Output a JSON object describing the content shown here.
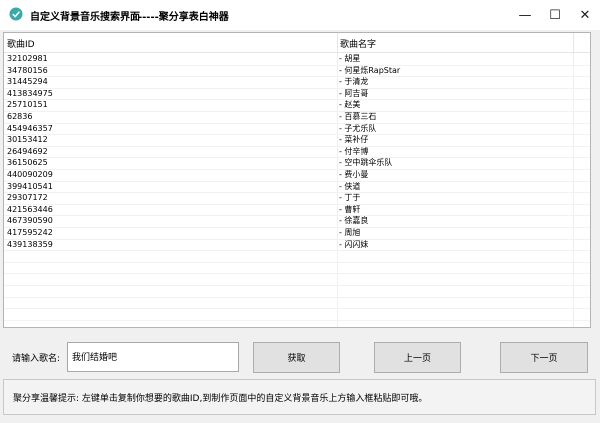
{
  "window": {
    "title": "自定义背景音乐搜索界面",
    "subtitle": "-----聚分享表白神器",
    "minimize": "—",
    "maximize": "☐",
    "close": "✕"
  },
  "list": {
    "columns": [
      "歌曲ID",
      "歌曲名字"
    ],
    "rows": [
      {
        "id": "32102981",
        "name": "- 胡星"
      },
      {
        "id": "34780156",
        "name": "- 何星烁RapStar"
      },
      {
        "id": "31445294",
        "name": "- 于清龙"
      },
      {
        "id": "413834975",
        "name": "- 阿吉哥"
      },
      {
        "id": "25710151",
        "name": "- 赵美"
      },
      {
        "id": "62836",
        "name": "- 百慕三石"
      },
      {
        "id": "454946357",
        "name": "- 子尤乐队"
      },
      {
        "id": "30153412",
        "name": "- 菜补仔"
      },
      {
        "id": "26494692",
        "name": "- 付辛博"
      },
      {
        "id": "36150625",
        "name": "- 空中跳伞乐队"
      },
      {
        "id": "440090209",
        "name": "- 费小曼"
      },
      {
        "id": "399410541",
        "name": "- 侠道"
      },
      {
        "id": "29307172",
        "name": "- 丁于"
      },
      {
        "id": "421563446",
        "name": "- 曹轩"
      },
      {
        "id": "467390590",
        "name": "- 徐嘉良"
      },
      {
        "id": "417595242",
        "name": "- 周旭"
      },
      {
        "id": "439138359",
        "name": "- 闪闪妹"
      }
    ]
  },
  "controls": {
    "input_label": "请输入歌名:",
    "input_value": "我们结婚吧",
    "search_button": "获取",
    "prev_button": "上一页",
    "next_button": "下一页"
  },
  "tip": "聚分享温馨提示: 左键单击复制你想要的歌曲ID,到制作页面中的自定义背景音乐上方输入框粘贴即可哦。",
  "colors": {
    "app_icon": "#3aa9a9"
  },
  "icons": {
    "app": "app-logo-icon"
  }
}
